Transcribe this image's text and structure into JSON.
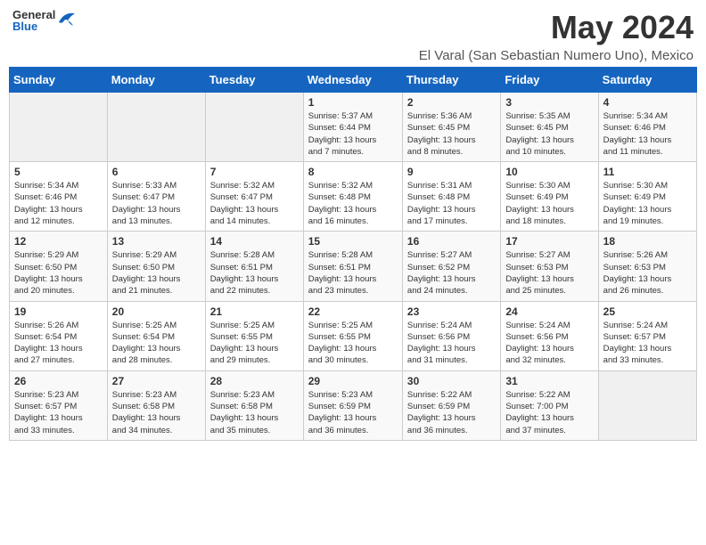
{
  "header": {
    "logo_general": "General",
    "logo_blue": "Blue",
    "month_title": "May 2024",
    "location": "El Varal (San Sebastian Numero Uno), Mexico"
  },
  "weekdays": [
    "Sunday",
    "Monday",
    "Tuesday",
    "Wednesday",
    "Thursday",
    "Friday",
    "Saturday"
  ],
  "weeks": [
    [
      {
        "day": "",
        "info": ""
      },
      {
        "day": "",
        "info": ""
      },
      {
        "day": "",
        "info": ""
      },
      {
        "day": "1",
        "info": "Sunrise: 5:37 AM\nSunset: 6:44 PM\nDaylight: 13 hours\nand 7 minutes."
      },
      {
        "day": "2",
        "info": "Sunrise: 5:36 AM\nSunset: 6:45 PM\nDaylight: 13 hours\nand 8 minutes."
      },
      {
        "day": "3",
        "info": "Sunrise: 5:35 AM\nSunset: 6:45 PM\nDaylight: 13 hours\nand 10 minutes."
      },
      {
        "day": "4",
        "info": "Sunrise: 5:34 AM\nSunset: 6:46 PM\nDaylight: 13 hours\nand 11 minutes."
      }
    ],
    [
      {
        "day": "5",
        "info": "Sunrise: 5:34 AM\nSunset: 6:46 PM\nDaylight: 13 hours\nand 12 minutes."
      },
      {
        "day": "6",
        "info": "Sunrise: 5:33 AM\nSunset: 6:47 PM\nDaylight: 13 hours\nand 13 minutes."
      },
      {
        "day": "7",
        "info": "Sunrise: 5:32 AM\nSunset: 6:47 PM\nDaylight: 13 hours\nand 14 minutes."
      },
      {
        "day": "8",
        "info": "Sunrise: 5:32 AM\nSunset: 6:48 PM\nDaylight: 13 hours\nand 16 minutes."
      },
      {
        "day": "9",
        "info": "Sunrise: 5:31 AM\nSunset: 6:48 PM\nDaylight: 13 hours\nand 17 minutes."
      },
      {
        "day": "10",
        "info": "Sunrise: 5:30 AM\nSunset: 6:49 PM\nDaylight: 13 hours\nand 18 minutes."
      },
      {
        "day": "11",
        "info": "Sunrise: 5:30 AM\nSunset: 6:49 PM\nDaylight: 13 hours\nand 19 minutes."
      }
    ],
    [
      {
        "day": "12",
        "info": "Sunrise: 5:29 AM\nSunset: 6:50 PM\nDaylight: 13 hours\nand 20 minutes."
      },
      {
        "day": "13",
        "info": "Sunrise: 5:29 AM\nSunset: 6:50 PM\nDaylight: 13 hours\nand 21 minutes."
      },
      {
        "day": "14",
        "info": "Sunrise: 5:28 AM\nSunset: 6:51 PM\nDaylight: 13 hours\nand 22 minutes."
      },
      {
        "day": "15",
        "info": "Sunrise: 5:28 AM\nSunset: 6:51 PM\nDaylight: 13 hours\nand 23 minutes."
      },
      {
        "day": "16",
        "info": "Sunrise: 5:27 AM\nSunset: 6:52 PM\nDaylight: 13 hours\nand 24 minutes."
      },
      {
        "day": "17",
        "info": "Sunrise: 5:27 AM\nSunset: 6:53 PM\nDaylight: 13 hours\nand 25 minutes."
      },
      {
        "day": "18",
        "info": "Sunrise: 5:26 AM\nSunset: 6:53 PM\nDaylight: 13 hours\nand 26 minutes."
      }
    ],
    [
      {
        "day": "19",
        "info": "Sunrise: 5:26 AM\nSunset: 6:54 PM\nDaylight: 13 hours\nand 27 minutes."
      },
      {
        "day": "20",
        "info": "Sunrise: 5:25 AM\nSunset: 6:54 PM\nDaylight: 13 hours\nand 28 minutes."
      },
      {
        "day": "21",
        "info": "Sunrise: 5:25 AM\nSunset: 6:55 PM\nDaylight: 13 hours\nand 29 minutes."
      },
      {
        "day": "22",
        "info": "Sunrise: 5:25 AM\nSunset: 6:55 PM\nDaylight: 13 hours\nand 30 minutes."
      },
      {
        "day": "23",
        "info": "Sunrise: 5:24 AM\nSunset: 6:56 PM\nDaylight: 13 hours\nand 31 minutes."
      },
      {
        "day": "24",
        "info": "Sunrise: 5:24 AM\nSunset: 6:56 PM\nDaylight: 13 hours\nand 32 minutes."
      },
      {
        "day": "25",
        "info": "Sunrise: 5:24 AM\nSunset: 6:57 PM\nDaylight: 13 hours\nand 33 minutes."
      }
    ],
    [
      {
        "day": "26",
        "info": "Sunrise: 5:23 AM\nSunset: 6:57 PM\nDaylight: 13 hours\nand 33 minutes."
      },
      {
        "day": "27",
        "info": "Sunrise: 5:23 AM\nSunset: 6:58 PM\nDaylight: 13 hours\nand 34 minutes."
      },
      {
        "day": "28",
        "info": "Sunrise: 5:23 AM\nSunset: 6:58 PM\nDaylight: 13 hours\nand 35 minutes."
      },
      {
        "day": "29",
        "info": "Sunrise: 5:23 AM\nSunset: 6:59 PM\nDaylight: 13 hours\nand 36 minutes."
      },
      {
        "day": "30",
        "info": "Sunrise: 5:22 AM\nSunset: 6:59 PM\nDaylight: 13 hours\nand 36 minutes."
      },
      {
        "day": "31",
        "info": "Sunrise: 5:22 AM\nSunset: 7:00 PM\nDaylight: 13 hours\nand 37 minutes."
      },
      {
        "day": "",
        "info": ""
      }
    ]
  ]
}
